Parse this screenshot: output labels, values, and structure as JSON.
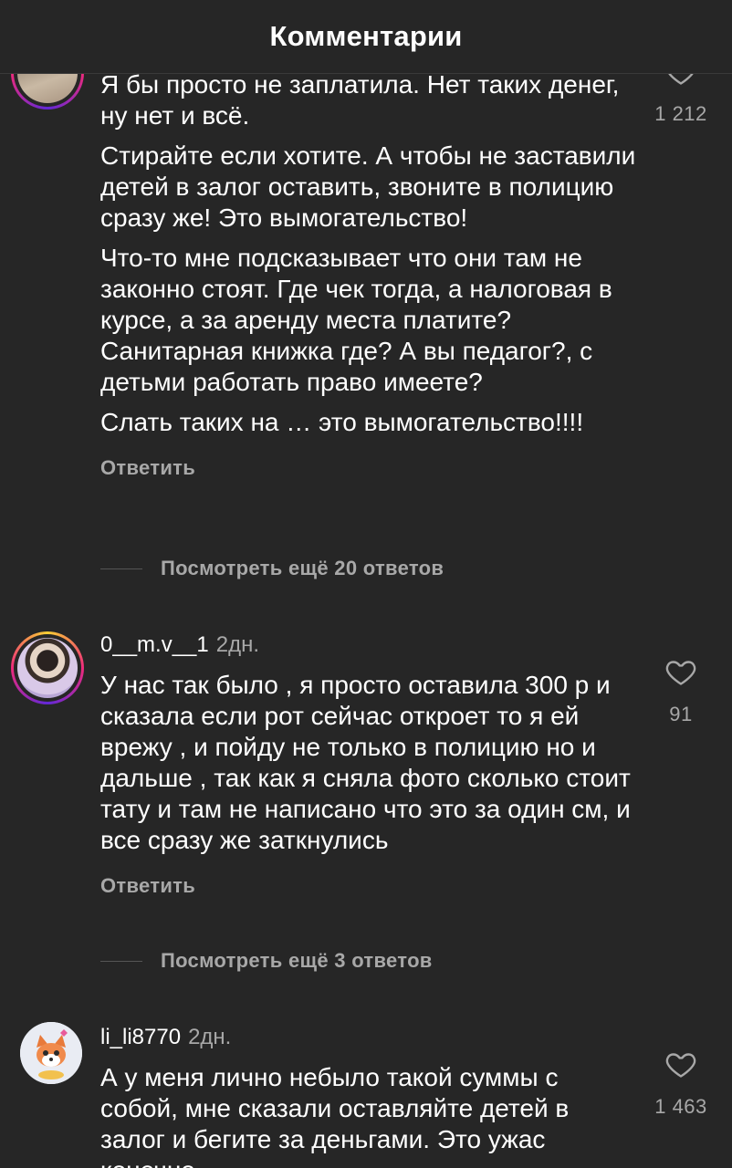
{
  "header": {
    "title": "Комментарии"
  },
  "comments": [
    {
      "paragraphs": [
        "Я бы просто не заплатила. Нет таких денег, ну нет и всё.",
        "Стирайте если хотите. А чтобы не заставили детей в залог оставить, звоните в полицию сразу же! Это вымогательство!",
        "Что-то мне подсказывает что они там не законно стоят. Где чек тогда, а налоговая в курсе, а за аренду места платите? Санитарная книжка где? А вы педагог?, с детьми работать право имеете?",
        "Слать таких на … это вымогательство!!!!"
      ],
      "reply_label": "Ответить",
      "view_more": "Посмотреть ещё 20 ответов",
      "likes": "1 212"
    },
    {
      "username": "0__m.v__1",
      "age": "2дн.",
      "paragraphs": [
        "У нас так было , я просто оставила 300 р и сказала если рот сейчас откроет то я ей врежу , и пойду не только в полицию но и дальше , так как я сняла фото сколько стоит тату и там не написано что это за один см, и все сразу же заткнулись"
      ],
      "reply_label": "Ответить",
      "view_more": "Посмотреть ещё 3 ответов",
      "likes": "91"
    },
    {
      "username": "li_li8770",
      "age": "2дн.",
      "paragraphs": [
        "А у меня лично небыло такой суммы с собой, мне сказали оставляйте детей в залог и бегите за деньгами. Это ужас конечно"
      ],
      "likes": "1 463"
    }
  ],
  "colors": {
    "background": "#262626",
    "secondary_text": "#a8a8a8",
    "primary_text": "#ffffff"
  }
}
